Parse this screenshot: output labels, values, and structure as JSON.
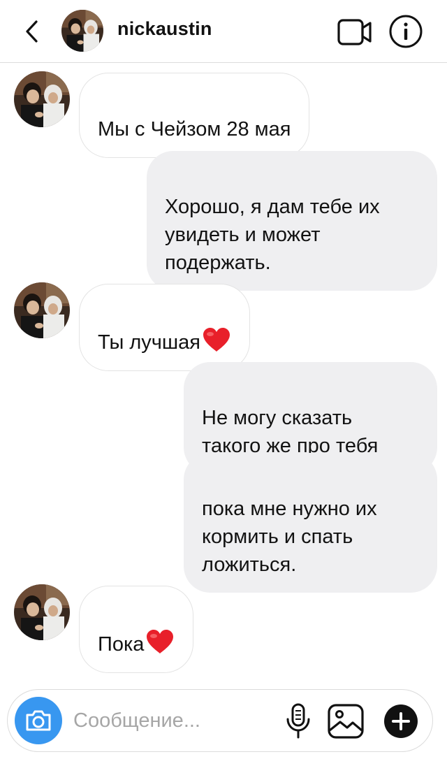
{
  "header": {
    "username": "nickaustin",
    "back_icon": "chevron-left-icon",
    "video_icon": "video-camera-icon",
    "info_icon": "info-icon"
  },
  "messages": [
    {
      "direction": "in",
      "text": "Мы с Чейзом 28 мая"
    },
    {
      "direction": "out",
      "text": "Хорошо, я дам тебе их\nувидеть и может\nподержать."
    },
    {
      "direction": "in",
      "text": "Ты лучшая",
      "emoji": "heart"
    },
    {
      "direction": "out",
      "text": "Не могу сказать\nтакого же про тебя"
    },
    {
      "direction": "out",
      "text": "пока мне нужно их\nкормить и спать\nложиться."
    },
    {
      "direction": "in",
      "text": "Пока",
      "emoji": "heart"
    }
  ],
  "composer": {
    "placeholder": "Сообщение...",
    "camera_icon": "camera-icon",
    "mic_icon": "microphone-icon",
    "gallery_icon": "image-icon",
    "plus_icon": "plus-icon"
  },
  "colors": {
    "accent": "#3897f0",
    "outgoing_bubble": "#efeff1",
    "heart": "#e8202a"
  }
}
